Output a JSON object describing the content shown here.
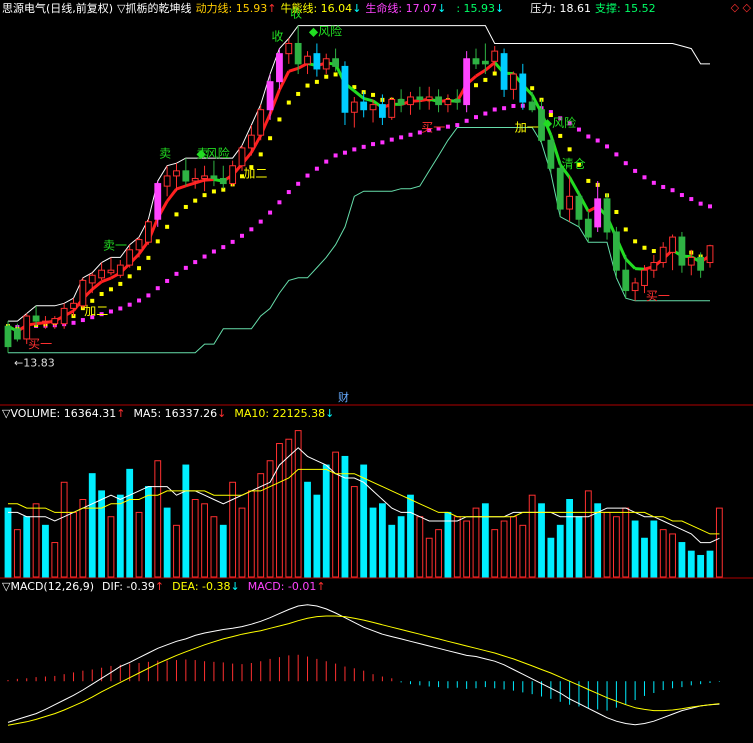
{
  "main_header": {
    "stock_name": "思源电气(日线,前复权)",
    "indicator_name": "▽抓栃的乾坤线",
    "dongli_label": "动力线: 15.93",
    "dongli_arrow": "↑",
    "niuxiong_label": "牛熊线: 16.04",
    "niuxiong_arrow": "↓",
    "shengming_label": "生命线: 17.07",
    "shengming_arrow": "↓",
    "extra_label": ": 15.93",
    "extra_arrow": "↓",
    "yali_label": "压力: 18.61",
    "zhicheng_label": "支撑: 15.52",
    "corner_icons": "◇ ◇"
  },
  "volume_header": {
    "title": "▽VOLUME: 16364.31",
    "title_arrow": "↑",
    "ma5_label": "MA5: 16337.26",
    "ma5_arrow": "↓",
    "ma10_label": "MA10: 22125.38",
    "ma10_arrow": "↓"
  },
  "macd_header": {
    "title": "▽MACD(12,26,9)",
    "dif_label": "DIF: -0.39",
    "dif_arrow": "↑",
    "dea_label": "DEA: -0.38",
    "dea_arrow": "↓",
    "macd_label": "MACD: -0.01",
    "macd_arrow": "↑"
  },
  "chart_data": {
    "type": "candlestick",
    "price_ylim": [
      13.0,
      20.4
    ],
    "low_label": "←13.83",
    "candles": [
      {
        "o": 13.95,
        "h": 14.45,
        "l": 13.83,
        "c": 14.35,
        "up": false,
        "cyan": false
      },
      {
        "o": 14.3,
        "h": 14.4,
        "l": 14.05,
        "c": 14.1,
        "up": false,
        "cyan": false
      },
      {
        "o": 14.1,
        "h": 14.6,
        "l": 14.0,
        "c": 14.55,
        "up": true,
        "cyan": false
      },
      {
        "o": 14.55,
        "h": 14.75,
        "l": 14.35,
        "c": 14.45,
        "up": false,
        "cyan": false
      },
      {
        "o": 14.45,
        "h": 14.55,
        "l": 14.3,
        "c": 14.45,
        "up": true,
        "cyan": false
      },
      {
        "o": 14.4,
        "h": 14.55,
        "l": 14.3,
        "c": 14.5,
        "up": true,
        "cyan": false
      },
      {
        "o": 14.4,
        "h": 14.8,
        "l": 14.3,
        "c": 14.7,
        "up": true,
        "cyan": false
      },
      {
        "o": 14.7,
        "h": 14.9,
        "l": 14.55,
        "c": 14.8,
        "up": true,
        "cyan": false
      },
      {
        "o": 14.75,
        "h": 15.3,
        "l": 14.7,
        "c": 15.25,
        "up": true,
        "cyan": false
      },
      {
        "o": 15.2,
        "h": 15.4,
        "l": 15.0,
        "c": 15.35,
        "up": true,
        "cyan": false
      },
      {
        "o": 15.3,
        "h": 15.6,
        "l": 15.25,
        "c": 15.45,
        "up": true,
        "cyan": false
      },
      {
        "o": 15.45,
        "h": 15.7,
        "l": 15.35,
        "c": 15.4,
        "up": true,
        "cyan": false
      },
      {
        "o": 15.35,
        "h": 15.65,
        "l": 15.3,
        "c": 15.55,
        "up": true,
        "cyan": false
      },
      {
        "o": 15.55,
        "h": 15.95,
        "l": 15.5,
        "c": 15.85,
        "up": true,
        "cyan": false
      },
      {
        "o": 15.85,
        "h": 16.1,
        "l": 15.7,
        "c": 16.05,
        "up": true,
        "cyan": false
      },
      {
        "o": 16.0,
        "h": 16.45,
        "l": 15.95,
        "c": 16.4,
        "up": true,
        "cyan": false
      },
      {
        "o": 16.45,
        "h": 17.2,
        "l": 16.3,
        "c": 17.15,
        "up": true,
        "cyan": false
      },
      {
        "o": 17.1,
        "h": 17.5,
        "l": 16.9,
        "c": 17.3,
        "up": true,
        "cyan": false
      },
      {
        "o": 17.3,
        "h": 17.55,
        "l": 17.0,
        "c": 17.4,
        "up": true,
        "cyan": false
      },
      {
        "o": 17.4,
        "h": 17.65,
        "l": 17.1,
        "c": 17.2,
        "up": false,
        "cyan": false
      },
      {
        "o": 17.2,
        "h": 17.45,
        "l": 17.05,
        "c": 17.25,
        "up": true,
        "cyan": false
      },
      {
        "o": 17.25,
        "h": 17.5,
        "l": 17.0,
        "c": 17.3,
        "up": true,
        "cyan": false
      },
      {
        "o": 17.3,
        "h": 17.6,
        "l": 17.1,
        "c": 17.25,
        "up": false,
        "cyan": false
      },
      {
        "o": 17.25,
        "h": 17.5,
        "l": 17.05,
        "c": 17.15,
        "up": false,
        "cyan": false
      },
      {
        "o": 17.15,
        "h": 17.6,
        "l": 17.1,
        "c": 17.5,
        "up": true,
        "cyan": false
      },
      {
        "o": 17.5,
        "h": 17.9,
        "l": 17.4,
        "c": 17.85,
        "up": true,
        "cyan": false
      },
      {
        "o": 17.85,
        "h": 18.3,
        "l": 17.7,
        "c": 18.1,
        "up": true,
        "cyan": false
      },
      {
        "o": 18.1,
        "h": 18.7,
        "l": 18.0,
        "c": 18.6,
        "up": true,
        "cyan": false
      },
      {
        "o": 18.6,
        "h": 19.3,
        "l": 18.4,
        "c": 19.15,
        "up": true,
        "cyan": false
      },
      {
        "o": 19.15,
        "h": 19.8,
        "l": 19.0,
        "c": 19.7,
        "up": true,
        "cyan": false
      },
      {
        "o": 19.7,
        "h": 20.0,
        "l": 19.5,
        "c": 19.9,
        "up": true,
        "cyan": false
      },
      {
        "o": 19.9,
        "h": 20.25,
        "l": 19.3,
        "c": 19.5,
        "up": false,
        "cyan": false
      },
      {
        "o": 19.5,
        "h": 19.75,
        "l": 19.3,
        "c": 19.65,
        "up": true,
        "cyan": false
      },
      {
        "o": 19.7,
        "h": 19.9,
        "l": 19.25,
        "c": 19.4,
        "up": false,
        "cyan": true
      },
      {
        "o": 19.4,
        "h": 19.7,
        "l": 19.3,
        "c": 19.6,
        "up": true,
        "cyan": false
      },
      {
        "o": 19.6,
        "h": 19.8,
        "l": 19.35,
        "c": 19.45,
        "up": false,
        "cyan": false
      },
      {
        "o": 19.45,
        "h": 19.55,
        "l": 18.3,
        "c": 18.55,
        "up": false,
        "cyan": true
      },
      {
        "o": 18.55,
        "h": 18.85,
        "l": 18.25,
        "c": 18.75,
        "up": true,
        "cyan": false
      },
      {
        "o": 18.75,
        "h": 18.95,
        "l": 18.45,
        "c": 18.6,
        "up": false,
        "cyan": true
      },
      {
        "o": 18.6,
        "h": 18.8,
        "l": 18.35,
        "c": 18.7,
        "up": true,
        "cyan": false
      },
      {
        "o": 18.7,
        "h": 18.9,
        "l": 18.3,
        "c": 18.45,
        "up": false,
        "cyan": true
      },
      {
        "o": 18.45,
        "h": 18.85,
        "l": 18.4,
        "c": 18.8,
        "up": true,
        "cyan": false
      },
      {
        "o": 18.8,
        "h": 19.0,
        "l": 18.55,
        "c": 18.7,
        "up": false,
        "cyan": false
      },
      {
        "o": 18.7,
        "h": 18.95,
        "l": 18.5,
        "c": 18.85,
        "up": true,
        "cyan": false
      },
      {
        "o": 18.85,
        "h": 19.05,
        "l": 18.6,
        "c": 18.8,
        "up": false,
        "cyan": false
      },
      {
        "o": 18.8,
        "h": 19.05,
        "l": 18.6,
        "c": 18.85,
        "up": true,
        "cyan": false
      },
      {
        "o": 18.85,
        "h": 19.0,
        "l": 18.55,
        "c": 18.7,
        "up": false,
        "cyan": false
      },
      {
        "o": 18.7,
        "h": 18.9,
        "l": 18.55,
        "c": 18.8,
        "up": true,
        "cyan": false
      },
      {
        "o": 18.8,
        "h": 19.0,
        "l": 18.6,
        "c": 18.75,
        "up": false,
        "cyan": false
      },
      {
        "o": 18.7,
        "h": 19.75,
        "l": 18.55,
        "c": 19.6,
        "up": true,
        "cyan": false
      },
      {
        "o": 19.6,
        "h": 19.8,
        "l": 19.4,
        "c": 19.5,
        "up": false,
        "cyan": false
      },
      {
        "o": 19.5,
        "h": 19.9,
        "l": 19.3,
        "c": 19.55,
        "up": false,
        "cyan": false
      },
      {
        "o": 19.55,
        "h": 19.85,
        "l": 19.35,
        "c": 19.75,
        "up": true,
        "cyan": false
      },
      {
        "o": 19.7,
        "h": 19.8,
        "l": 18.85,
        "c": 19.0,
        "up": false,
        "cyan": true
      },
      {
        "o": 19.0,
        "h": 19.35,
        "l": 18.8,
        "c": 19.3,
        "up": true,
        "cyan": false
      },
      {
        "o": 19.3,
        "h": 19.5,
        "l": 18.6,
        "c": 18.75,
        "up": false,
        "cyan": true
      },
      {
        "o": 18.75,
        "h": 18.95,
        "l": 18.55,
        "c": 18.6,
        "up": false,
        "cyan": false
      },
      {
        "o": 18.6,
        "h": 18.8,
        "l": 17.95,
        "c": 18.0,
        "up": false,
        "cyan": false
      },
      {
        "o": 18.0,
        "h": 18.1,
        "l": 17.35,
        "c": 17.45,
        "up": false,
        "cyan": false
      },
      {
        "o": 17.45,
        "h": 17.6,
        "l": 16.5,
        "c": 16.65,
        "up": false,
        "cyan": false
      },
      {
        "o": 16.65,
        "h": 17.3,
        "l": 16.4,
        "c": 16.9,
        "up": true,
        "cyan": false
      },
      {
        "o": 16.9,
        "h": 17.0,
        "l": 16.3,
        "c": 16.45,
        "up": false,
        "cyan": false
      },
      {
        "o": 16.45,
        "h": 16.6,
        "l": 16.0,
        "c": 16.1,
        "up": false,
        "cyan": false
      },
      {
        "o": 16.3,
        "h": 17.2,
        "l": 16.2,
        "c": 16.85,
        "up": true,
        "cyan": false
      },
      {
        "o": 16.85,
        "h": 16.95,
        "l": 16.05,
        "c": 16.2,
        "up": false,
        "cyan": false
      },
      {
        "o": 16.2,
        "h": 16.3,
        "l": 15.3,
        "c": 15.45,
        "up": false,
        "cyan": false
      },
      {
        "o": 15.45,
        "h": 15.75,
        "l": 14.9,
        "c": 15.05,
        "up": false,
        "cyan": false
      },
      {
        "o": 15.05,
        "h": 15.3,
        "l": 14.85,
        "c": 15.2,
        "up": true,
        "cyan": false
      },
      {
        "o": 15.15,
        "h": 15.55,
        "l": 15.0,
        "c": 15.45,
        "up": true,
        "cyan": false
      },
      {
        "o": 15.45,
        "h": 15.75,
        "l": 15.3,
        "c": 15.6,
        "up": true,
        "cyan": false
      },
      {
        "o": 15.6,
        "h": 16.0,
        "l": 15.5,
        "c": 15.9,
        "up": true,
        "cyan": false
      },
      {
        "o": 15.8,
        "h": 16.15,
        "l": 15.45,
        "c": 16.1,
        "up": true,
        "cyan": false
      },
      {
        "o": 16.1,
        "h": 16.2,
        "l": 15.4,
        "c": 15.55,
        "up": false,
        "cyan": false
      },
      {
        "o": 15.55,
        "h": 15.85,
        "l": 15.35,
        "c": 15.7,
        "up": true,
        "cyan": false
      },
      {
        "o": 15.7,
        "h": 15.8,
        "l": 15.3,
        "c": 15.45,
        "up": false,
        "cyan": false
      },
      {
        "o": 15.6,
        "h": 15.95,
        "l": 15.5,
        "c": 15.93,
        "up": true,
        "cyan": false
      }
    ],
    "signals": [
      {
        "i": 3,
        "text": "买一",
        "kind": "buy"
      },
      {
        "i": 17,
        "text": "卖",
        "kind": "sell"
      },
      {
        "i": 29,
        "text": "收",
        "kind": "sell"
      },
      {
        "i": 31,
        "text": "收",
        "kind": "sell"
      },
      {
        "i": 33,
        "text": "风险",
        "kind": "risk"
      },
      {
        "i": 45,
        "text": "买一",
        "kind": "buy"
      },
      {
        "i": 58,
        "text": "风险",
        "kind": "risk"
      },
      {
        "i": 60,
        "text": "清仓",
        "kind": "clear"
      },
      {
        "i": 69,
        "text": "买一",
        "kind": "buy"
      },
      {
        "i": 21,
        "text": "卖",
        "kind": "sell"
      },
      {
        "i": 21,
        "text": "风险",
        "kind": "risk"
      },
      {
        "i": 26,
        "text": "加二",
        "kind": "add"
      },
      {
        "i": 9,
        "text": "加二",
        "kind": "add"
      },
      {
        "i": 55,
        "text": "加一",
        "kind": "add"
      },
      {
        "i": 11,
        "text": "卖一",
        "kind": "sell"
      }
    ],
    "finance_marker": "财",
    "volume_values": [
      16,
      11,
      14,
      17,
      12,
      8,
      22,
      15,
      18,
      24,
      20,
      14,
      19,
      25,
      15,
      21,
      27,
      16,
      12,
      26,
      18,
      17,
      14,
      12,
      22,
      16,
      20,
      24,
      27,
      31,
      32,
      34,
      22,
      19,
      26,
      29,
      28,
      21,
      26,
      16,
      17,
      12,
      14,
      19,
      14,
      9,
      11,
      15,
      14,
      13,
      16,
      17,
      11,
      13,
      14,
      12,
      19,
      17,
      9,
      12,
      18,
      14,
      20,
      17,
      15,
      14,
      16,
      13,
      9,
      13,
      11,
      10,
      8,
      6,
      5,
      6,
      16
    ],
    "volume_cyan": [
      true,
      false,
      true,
      false,
      true,
      false,
      false,
      false,
      false,
      true,
      true,
      false,
      true,
      true,
      false,
      true,
      false,
      true,
      false,
      true,
      false,
      false,
      false,
      true,
      false,
      false,
      false,
      false,
      false,
      false,
      false,
      false,
      true,
      true,
      true,
      false,
      true,
      false,
      true,
      true,
      true,
      true,
      true,
      true,
      false,
      false,
      false,
      true,
      false,
      false,
      false,
      true,
      false,
      false,
      false,
      false,
      false,
      true,
      true,
      true,
      true,
      true,
      false,
      true,
      false,
      false,
      false,
      true,
      true,
      true,
      false,
      false,
      true,
      true,
      true,
      true,
      false
    ],
    "ma5_values": [
      15,
      15,
      14,
      14,
      14,
      13,
      14,
      15,
      16,
      17,
      18,
      19,
      18,
      19,
      20,
      21,
      21,
      21,
      19,
      20,
      20,
      19,
      18,
      17,
      18,
      19,
      20,
      21,
      22,
      26,
      28,
      30,
      28,
      27,
      26,
      24,
      23,
      23,
      22,
      20,
      18,
      16,
      15,
      15,
      14,
      13,
      13,
      13,
      13,
      14,
      14,
      14,
      14,
      14,
      15,
      15,
      15,
      15,
      15,
      14,
      14,
      14,
      14,
      15,
      16,
      16,
      16,
      15,
      14,
      14,
      13,
      12,
      11,
      10,
      8,
      8,
      9
    ],
    "ma10_values": [
      17,
      17,
      16,
      16,
      16,
      15,
      15,
      15,
      16,
      16,
      16,
      17,
      17,
      18,
      18,
      19,
      19,
      20,
      20,
      20,
      20,
      20,
      19,
      19,
      19,
      19,
      20,
      20,
      21,
      22,
      23,
      25,
      25,
      25,
      25,
      24,
      24,
      24,
      23,
      22,
      21,
      20,
      19,
      18,
      17,
      16,
      15,
      15,
      14,
      14,
      14,
      14,
      14,
      14,
      14,
      15,
      15,
      15,
      15,
      15,
      15,
      15,
      15,
      15,
      15,
      15,
      15,
      15,
      15,
      14,
      14,
      13,
      13,
      12,
      11,
      10,
      10
    ],
    "macd_hist": [
      0.02,
      0.04,
      0.05,
      0.07,
      0.08,
      0.09,
      0.12,
      0.15,
      0.18,
      0.2,
      0.23,
      0.26,
      0.28,
      0.3,
      0.31,
      0.33,
      0.35,
      0.35,
      0.36,
      0.37,
      0.36,
      0.34,
      0.33,
      0.32,
      0.3,
      0.29,
      0.31,
      0.34,
      0.38,
      0.41,
      0.44,
      0.45,
      0.42,
      0.38,
      0.34,
      0.3,
      0.25,
      0.22,
      0.18,
      0.12,
      0.08,
      0.05,
      -0.02,
      -0.05,
      -0.07,
      -0.09,
      -0.1,
      -0.12,
      -0.11,
      -0.13,
      -0.12,
      -0.1,
      -0.12,
      -0.14,
      -0.16,
      -0.19,
      -0.22,
      -0.26,
      -0.3,
      -0.35,
      -0.4,
      -0.43,
      -0.46,
      -0.48,
      -0.5,
      -0.45,
      -0.4,
      -0.32,
      -0.25,
      -0.2,
      -0.15,
      -0.12,
      -0.1,
      -0.07,
      -0.05,
      -0.03,
      -0.01
    ],
    "dif_values": [
      -0.7,
      -0.65,
      -0.6,
      -0.55,
      -0.48,
      -0.4,
      -0.32,
      -0.24,
      -0.15,
      -0.05,
      0.05,
      0.15,
      0.25,
      0.32,
      0.4,
      0.48,
      0.56,
      0.62,
      0.68,
      0.72,
      0.78,
      0.82,
      0.85,
      0.88,
      0.9,
      0.93,
      0.97,
      1.02,
      1.08,
      1.15,
      1.22,
      1.28,
      1.3,
      1.28,
      1.23,
      1.16,
      1.08,
      1.0,
      0.92,
      0.86,
      0.8,
      0.76,
      0.72,
      0.68,
      0.64,
      0.6,
      0.56,
      0.52,
      0.48,
      0.44,
      0.42,
      0.38,
      0.34,
      0.28,
      0.2,
      0.12,
      0.04,
      -0.04,
      -0.12,
      -0.2,
      -0.3,
      -0.38,
      -0.46,
      -0.54,
      -0.62,
      -0.68,
      -0.72,
      -0.74,
      -0.72,
      -0.68,
      -0.62,
      -0.56,
      -0.5,
      -0.46,
      -0.42,
      -0.4,
      -0.39
    ],
    "dea_values": [
      -0.75,
      -0.72,
      -0.69,
      -0.65,
      -0.6,
      -0.55,
      -0.49,
      -0.42,
      -0.35,
      -0.27,
      -0.18,
      -0.1,
      -0.02,
      0.06,
      0.14,
      0.22,
      0.3,
      0.37,
      0.44,
      0.5,
      0.56,
      0.62,
      0.67,
      0.72,
      0.76,
      0.8,
      0.83,
      0.86,
      0.9,
      0.94,
      0.98,
      1.03,
      1.07,
      1.1,
      1.11,
      1.11,
      1.1,
      1.07,
      1.04,
      1.0,
      0.96,
      0.92,
      0.88,
      0.84,
      0.8,
      0.76,
      0.72,
      0.68,
      0.64,
      0.6,
      0.56,
      0.52,
      0.48,
      0.43,
      0.38,
      0.32,
      0.26,
      0.2,
      0.14,
      0.07,
      0.0,
      -0.07,
      -0.14,
      -0.21,
      -0.28,
      -0.34,
      -0.4,
      -0.45,
      -0.48,
      -0.5,
      -0.5,
      -0.49,
      -0.47,
      -0.44,
      -0.42,
      -0.4,
      -0.38
    ],
    "macd_ylim": [
      -1.0,
      1.45
    ],
    "volume_ylim": [
      0,
      36
    ]
  }
}
